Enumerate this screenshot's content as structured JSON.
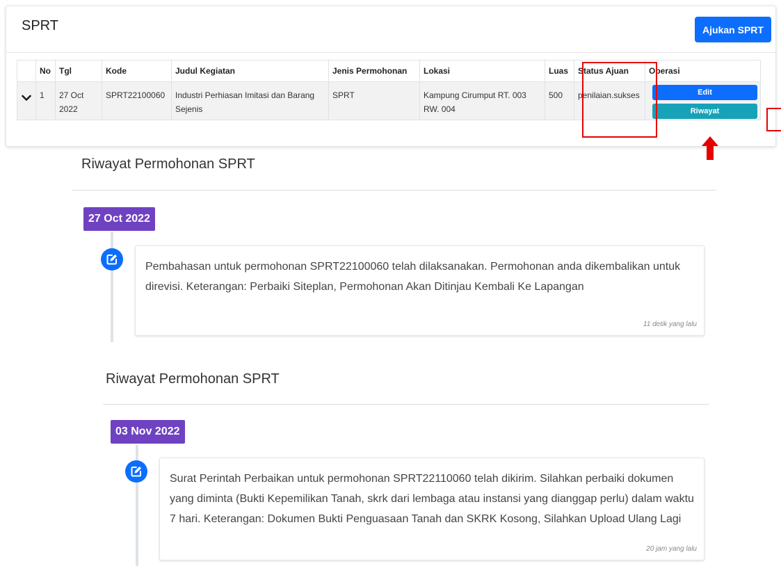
{
  "header": {
    "title": "SPRT",
    "submit_label": "Ajukan SPRT"
  },
  "table": {
    "columns": [
      "No",
      "Tgl",
      "Kode",
      "Judul Kegiatan",
      "Jenis Permohonan",
      "Lokasi",
      "Luas",
      "Status Ajuan",
      "Operasi"
    ],
    "rows": [
      {
        "no": "1",
        "tgl": "27 Oct 2022",
        "kode": "SPRT22100060",
        "judul": "Industri Perhiasan Imitasi dan Barang Sejenis",
        "jenis": "SPRT",
        "lokasi": "Kampung Cirumput RT. 003 RW. 004",
        "luas": "500",
        "status": "penilaian.sukses",
        "edit_label": "Edit",
        "riwayat_label": "Riwayat"
      }
    ]
  },
  "history": [
    {
      "title": "Riwayat Permohonan SPRT",
      "date": "27 Oct 2022",
      "message": "Pembahasan untuk permohonan SPRT22100060 telah dilaksanakan. Permohonan anda dikembalikan untuk direvisi. Keterangan: Perbaiki Siteplan, Permohonan Akan Ditinjau Kembali Ke Lapangan",
      "time": "11 detik yang lalu"
    },
    {
      "title": "Riwayat Permohonan SPRT",
      "date": "03 Nov 2022",
      "message": "Surat Perintah Perbaikan untuk permohonan SPRT22110060 telah dikirim. Silahkan perbaiki dokumen yang diminta (Bukti Kepemilikan Tanah, skrk dari lembaga atau instansi yang dianggap perlu) dalam waktu 7 hari. Keterangan: Dokumen Bukti Penguasaan Tanah dan SKRK Kosong, Silahkan Upload Ulang Lagi",
      "time": "20 jam yang lalu"
    }
  ],
  "icons": {
    "expand": "chevron-down-icon",
    "edit": "edit-square-icon",
    "annotation": "red-up-arrow-icon"
  },
  "colors": {
    "primary": "#0d6efd",
    "info": "#17a2b8",
    "badge": "#6f42c1",
    "highlight": "#e60000"
  }
}
